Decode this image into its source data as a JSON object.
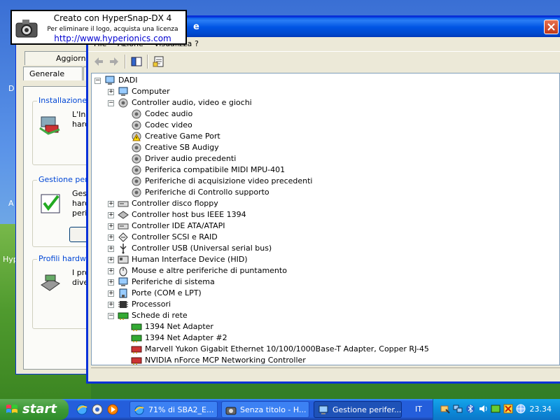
{
  "hypersnap": {
    "line1": "Creato con HyperSnap-DX 4",
    "line2": "Per eliminare il logo, acquista una licenza",
    "line3": "http://www.hyperionics.com"
  },
  "desktop": {
    "letters": [
      "D",
      "A",
      "Hyp"
    ]
  },
  "sysprop": {
    "tabs_row1": [
      "Aggiornam"
    ],
    "tabs_row2": [
      "Generale"
    ],
    "groups": [
      {
        "legend": "Installazione g",
        "text": "L'Ins\nhard"
      },
      {
        "legend": "Gestione perife",
        "text": "Ges\nhard\nperif"
      },
      {
        "legend": "Profili hardware",
        "text": "I pro\ndive"
      }
    ]
  },
  "devmgr": {
    "title": "e",
    "menu": [
      "File",
      "Azione",
      "Visualizza",
      "?"
    ],
    "toolbar": [
      "back-icon",
      "forward-icon",
      "properties-pane-icon",
      "properties-icon"
    ],
    "tree": [
      {
        "label": "DADI",
        "level": 0,
        "expander": "-",
        "icon": "computer"
      },
      {
        "label": "Computer",
        "level": 1,
        "expander": "+",
        "icon": "computer"
      },
      {
        "label": "Controller audio, video e giochi",
        "level": 1,
        "expander": "-",
        "icon": "audio"
      },
      {
        "label": "Codec audio",
        "level": 2,
        "icon": "audio"
      },
      {
        "label": "Codec video",
        "level": 2,
        "icon": "audio"
      },
      {
        "label": "Creative Game Port",
        "level": 2,
        "icon": "warning"
      },
      {
        "label": "Creative SB Audigy",
        "level": 2,
        "icon": "audio"
      },
      {
        "label": "Driver audio precedenti",
        "level": 2,
        "icon": "audio"
      },
      {
        "label": "Periferica compatibile MIDI MPU-401",
        "level": 2,
        "icon": "audio"
      },
      {
        "label": "Periferiche di acquisizione video precedenti",
        "level": 2,
        "icon": "audio"
      },
      {
        "label": "Periferiche di Controllo supporto",
        "level": 2,
        "icon": "audio"
      },
      {
        "label": "Controller disco floppy",
        "level": 1,
        "expander": "+",
        "icon": "disk"
      },
      {
        "label": "Controller host bus IEEE 1394",
        "level": 1,
        "expander": "+",
        "icon": "bus"
      },
      {
        "label": "Controller IDE ATA/ATAPI",
        "level": 1,
        "expander": "+",
        "icon": "disk"
      },
      {
        "label": "Controller SCSI e RAID",
        "level": 1,
        "expander": "+",
        "icon": "scsi"
      },
      {
        "label": "Controller USB (Universal serial bus)",
        "level": 1,
        "expander": "+",
        "icon": "usb"
      },
      {
        "label": "Human Interface Device (HID)",
        "level": 1,
        "expander": "+",
        "icon": "hid"
      },
      {
        "label": "Mouse e altre periferiche di puntamento",
        "level": 1,
        "expander": "+",
        "icon": "mouse"
      },
      {
        "label": "Periferiche di sistema",
        "level": 1,
        "expander": "+",
        "icon": "computer"
      },
      {
        "label": "Porte (COM e LPT)",
        "level": 1,
        "expander": "+",
        "icon": "port"
      },
      {
        "label": "Processori",
        "level": 1,
        "expander": "+",
        "icon": "cpu"
      },
      {
        "label": "Schede di rete",
        "level": 1,
        "expander": "-",
        "icon": "net"
      },
      {
        "label": "1394 Net Adapter",
        "level": 2,
        "icon": "net"
      },
      {
        "label": "1394 Net Adapter #2",
        "level": 2,
        "icon": "net"
      },
      {
        "label": "Marvell Yukon Gigabit Ethernet 10/100/1000Base-T Adapter, Copper RJ-45",
        "level": 2,
        "icon": "netred"
      },
      {
        "label": "NVIDIA nForce MCP Networking Controller",
        "level": 2,
        "icon": "netred"
      }
    ]
  },
  "taskbar": {
    "start_label": "start",
    "tasks": [
      {
        "label": "71% di SBA2_E...",
        "icon": "ie-icon"
      },
      {
        "label": "Senza titolo - H...",
        "icon": "hypersnap-icon"
      },
      {
        "label": "Gestione perifer...",
        "icon": "device-manager-icon"
      }
    ],
    "language": "IT",
    "clock": "23.34"
  },
  "colors": {
    "xp_blue": "#0054e3",
    "taskbar": "#245edb",
    "start_green": "#3c9a35",
    "tray": "#0c8ddb"
  }
}
